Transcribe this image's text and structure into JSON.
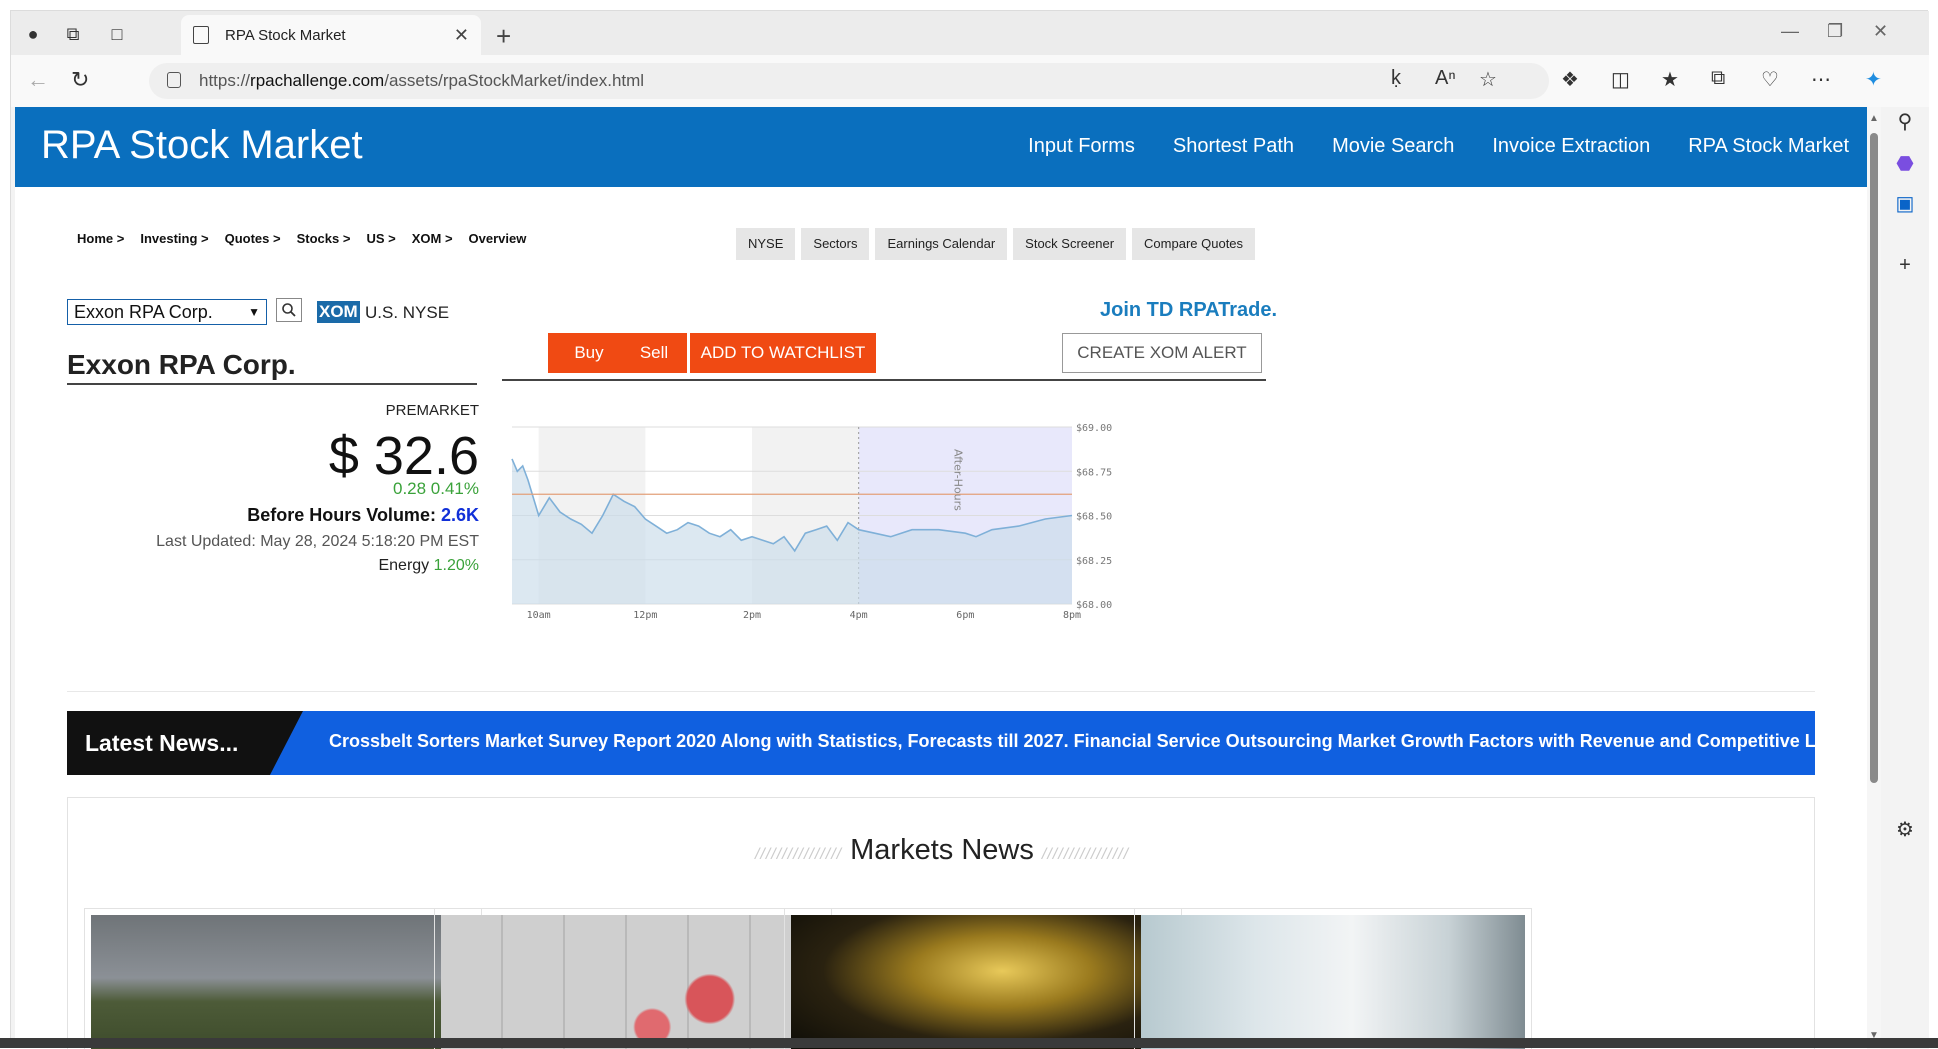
{
  "browser": {
    "tab_title": "RPA Stock Market",
    "url_scheme": "https://",
    "url_host": "rpachallenge.com",
    "url_path": "/assets/rpaStockMarket/index.html"
  },
  "site": {
    "title": "RPA Stock Market",
    "nav": [
      "Input Forms",
      "Shortest Path",
      "Movie Search",
      "Invoice Extraction",
      "RPA Stock Market"
    ]
  },
  "breadcrumb": [
    "Home >",
    "Investing >",
    "Quotes >",
    "Stocks >",
    "US >",
    "XOM >",
    "Overview"
  ],
  "subnav": [
    "NYSE",
    "Sectors",
    "Earnings Calendar",
    "Stock Screener",
    "Compare Quotes"
  ],
  "quote": {
    "selected_company": "Exxon RPA Corp.",
    "ticker": "XOM",
    "exchange": "U.S. NYSE",
    "join_text": "Join TD RPATrade.",
    "company_name": "Exxon RPA Corp.",
    "buy_label": "Buy",
    "sell_label": "Sell",
    "watchlist_label": "ADD TO WATCHLIST",
    "alert_label": "CREATE XOM ALERT",
    "premarket_label": "PREMARKET",
    "price": "$ 32.6",
    "change": "0.28 0.41%",
    "volume_label": "Before Hours Volume:",
    "volume_value": "2.6K",
    "last_updated": "Last Updated: May 28, 2024 5:18:20 PM EST",
    "sector_label": "Energy",
    "sector_change": "1.20%"
  },
  "chart_data": {
    "type": "area",
    "x_ticks": [
      "10am",
      "12pm",
      "2pm",
      "4pm",
      "6pm",
      "8pm"
    ],
    "y_ticks": [
      "$69.00",
      "$68.75",
      "$68.50",
      "$68.25",
      "$68.00"
    ],
    "ylim": [
      68.0,
      69.0
    ],
    "annotation": "After-Hours",
    "reference_line": 68.62,
    "x_hours": [
      9.5,
      9.6,
      9.7,
      9.8,
      10.0,
      10.1,
      10.2,
      10.4,
      10.6,
      10.8,
      11.0,
      11.2,
      11.4,
      11.6,
      11.8,
      12.0,
      12.2,
      12.4,
      12.6,
      12.8,
      13.0,
      13.2,
      13.4,
      13.6,
      13.8,
      14.0,
      14.2,
      14.4,
      14.6,
      14.8,
      15.0,
      15.2,
      15.4,
      15.6,
      15.8,
      16.0,
      16.3,
      16.6,
      17.0,
      17.5,
      18.0,
      18.2,
      18.5,
      19.0,
      19.5,
      20.0
    ],
    "values": [
      68.82,
      68.75,
      68.78,
      68.7,
      68.5,
      68.55,
      68.6,
      68.52,
      68.48,
      68.45,
      68.4,
      68.5,
      68.62,
      68.58,
      68.55,
      68.48,
      68.44,
      68.4,
      68.42,
      68.46,
      68.44,
      68.4,
      68.38,
      68.42,
      68.36,
      68.38,
      68.36,
      68.34,
      68.38,
      68.3,
      68.4,
      68.42,
      68.44,
      68.36,
      68.46,
      68.42,
      68.4,
      68.38,
      68.42,
      68.42,
      68.4,
      68.38,
      68.42,
      68.44,
      68.48,
      68.5
    ]
  },
  "news": {
    "label": "Latest News...",
    "ticker": "Crossbelt Sorters Market Survey Report 2020 Along with Statistics, Forecasts till 2027. Financial Service Outsourcing Market Growth Factors with Revenue and Competitive Landscape"
  },
  "markets": {
    "title": "Markets News",
    "slashes": "////////////////"
  }
}
